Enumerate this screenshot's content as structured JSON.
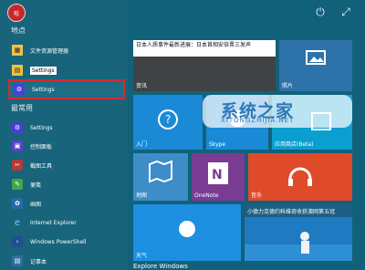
{
  "profile": {
    "label": "啦"
  },
  "top": {
    "power": "⏻",
    "expand": "⤢"
  },
  "sections": {
    "places": "地点",
    "most_used": "最常用"
  },
  "left_items": [
    {
      "label": "文件资源管理器"
    },
    {
      "label": "Settings"
    },
    {
      "label": "Settings"
    },
    {
      "label": "Settings"
    },
    {
      "label": "控制面板"
    },
    {
      "label": "截图工具"
    },
    {
      "label": "便笺"
    },
    {
      "label": "画图"
    },
    {
      "label": "Internet Explorer"
    },
    {
      "label": "Windows PowerShell"
    },
    {
      "label": "记事本"
    }
  ],
  "tiles": {
    "news": {
      "headline": "日本人质事件最新进展：日本首相安倍晋三发声",
      "label": "资讯"
    },
    "photo": {
      "label": "照片"
    },
    "help": {
      "label": "入门"
    },
    "skype": {
      "label": "Skype"
    },
    "store": {
      "label": "应用商店(Beta)"
    },
    "map": {
      "label": "地图"
    },
    "onenote": {
      "label": "OneNote"
    },
    "music": {
      "label": "音乐"
    },
    "weather": {
      "label": "天气"
    },
    "sports": {
      "headline": "小德力克德约科维奇收获澳网第五冠",
      "label": ""
    }
  },
  "watermark": {
    "title": "系统之家",
    "subtitle": "XITONGZHIJIA.NET"
  },
  "explore": "Explore Windows"
}
